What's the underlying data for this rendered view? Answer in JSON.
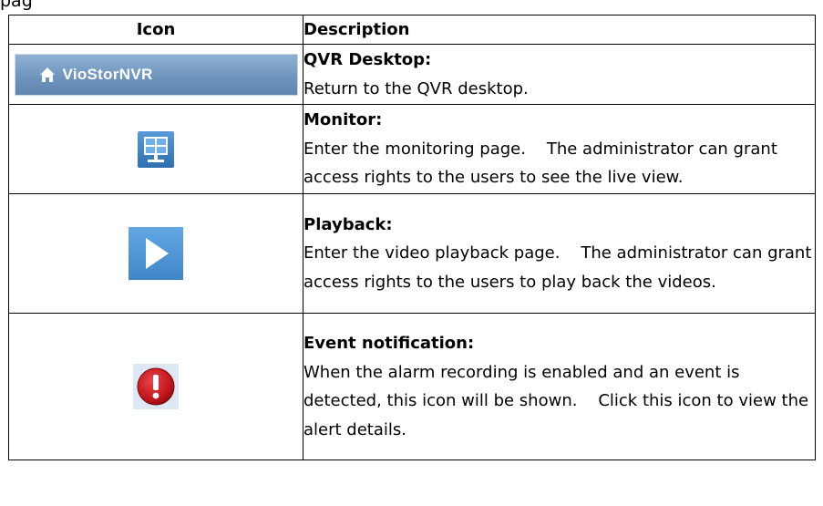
{
  "page_fragment": "pag",
  "table": {
    "headers": {
      "icon": "Icon",
      "description": "Description"
    },
    "rows": [
      {
        "icon": "qvr-desktop-button",
        "icon_label": "VioStorNVR",
        "title": "QVR Desktop:",
        "description": "Return to the QVR desktop."
      },
      {
        "icon": "monitor-icon",
        "title": "Monitor:",
        "description": "Enter the monitoring page.    The administrator can grant access rights to the users to see the live view."
      },
      {
        "icon": "playback-icon",
        "title": "Playback:",
        "description": "Enter the video playback page.    The administrator can grant access rights to the users to play back the videos."
      },
      {
        "icon": "event-notification-icon",
        "title": "Event notification:",
        "description": "When the alarm recording is enabled and an event is detected, this icon will be shown.    Click this icon to view the alert details."
      }
    ]
  },
  "colors": {
    "qvr_button": "#6d92bb",
    "monitor_tile": "#3d83c7",
    "play_tile": "#4f97d6",
    "alert_red": "#c3161c"
  }
}
